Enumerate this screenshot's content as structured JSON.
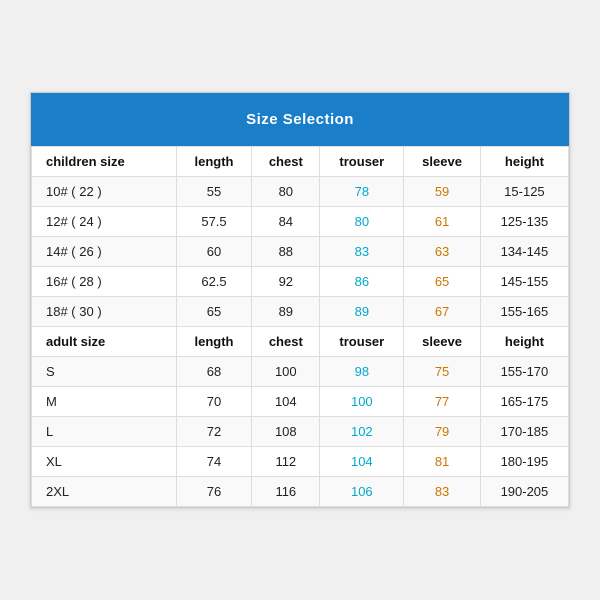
{
  "title": "Size Selection",
  "children_header": {
    "size": "children size",
    "length": "length",
    "chest": "chest",
    "trouser": "trouser",
    "sleeve": "sleeve",
    "height": "height"
  },
  "children_rows": [
    {
      "size": "10# ( 22 )",
      "length": "55",
      "chest": "80",
      "trouser": "78",
      "sleeve": "59",
      "height": "15-125"
    },
    {
      "size": "12# ( 24 )",
      "length": "57.5",
      "chest": "84",
      "trouser": "80",
      "sleeve": "61",
      "height": "125-135"
    },
    {
      "size": "14# ( 26 )",
      "length": "60",
      "chest": "88",
      "trouser": "83",
      "sleeve": "63",
      "height": "134-145"
    },
    {
      "size": "16# ( 28 )",
      "length": "62.5",
      "chest": "92",
      "trouser": "86",
      "sleeve": "65",
      "height": "145-155"
    },
    {
      "size": "18# ( 30 )",
      "length": "65",
      "chest": "89",
      "trouser": "89",
      "sleeve": "67",
      "height": "155-165"
    }
  ],
  "adult_header": {
    "size": "adult size",
    "length": "length",
    "chest": "chest",
    "trouser": "trouser",
    "sleeve": "sleeve",
    "height": "height"
  },
  "adult_rows": [
    {
      "size": "S",
      "length": "68",
      "chest": "100",
      "trouser": "98",
      "sleeve": "75",
      "height": "155-170"
    },
    {
      "size": "M",
      "length": "70",
      "chest": "104",
      "trouser": "100",
      "sleeve": "77",
      "height": "165-175"
    },
    {
      "size": "L",
      "length": "72",
      "chest": "108",
      "trouser": "102",
      "sleeve": "79",
      "height": "170-185"
    },
    {
      "size": "XL",
      "length": "74",
      "chest": "112",
      "trouser": "104",
      "sleeve": "81",
      "height": "180-195"
    },
    {
      "size": "2XL",
      "length": "76",
      "chest": "116",
      "trouser": "106",
      "sleeve": "83",
      "height": "190-205"
    }
  ]
}
